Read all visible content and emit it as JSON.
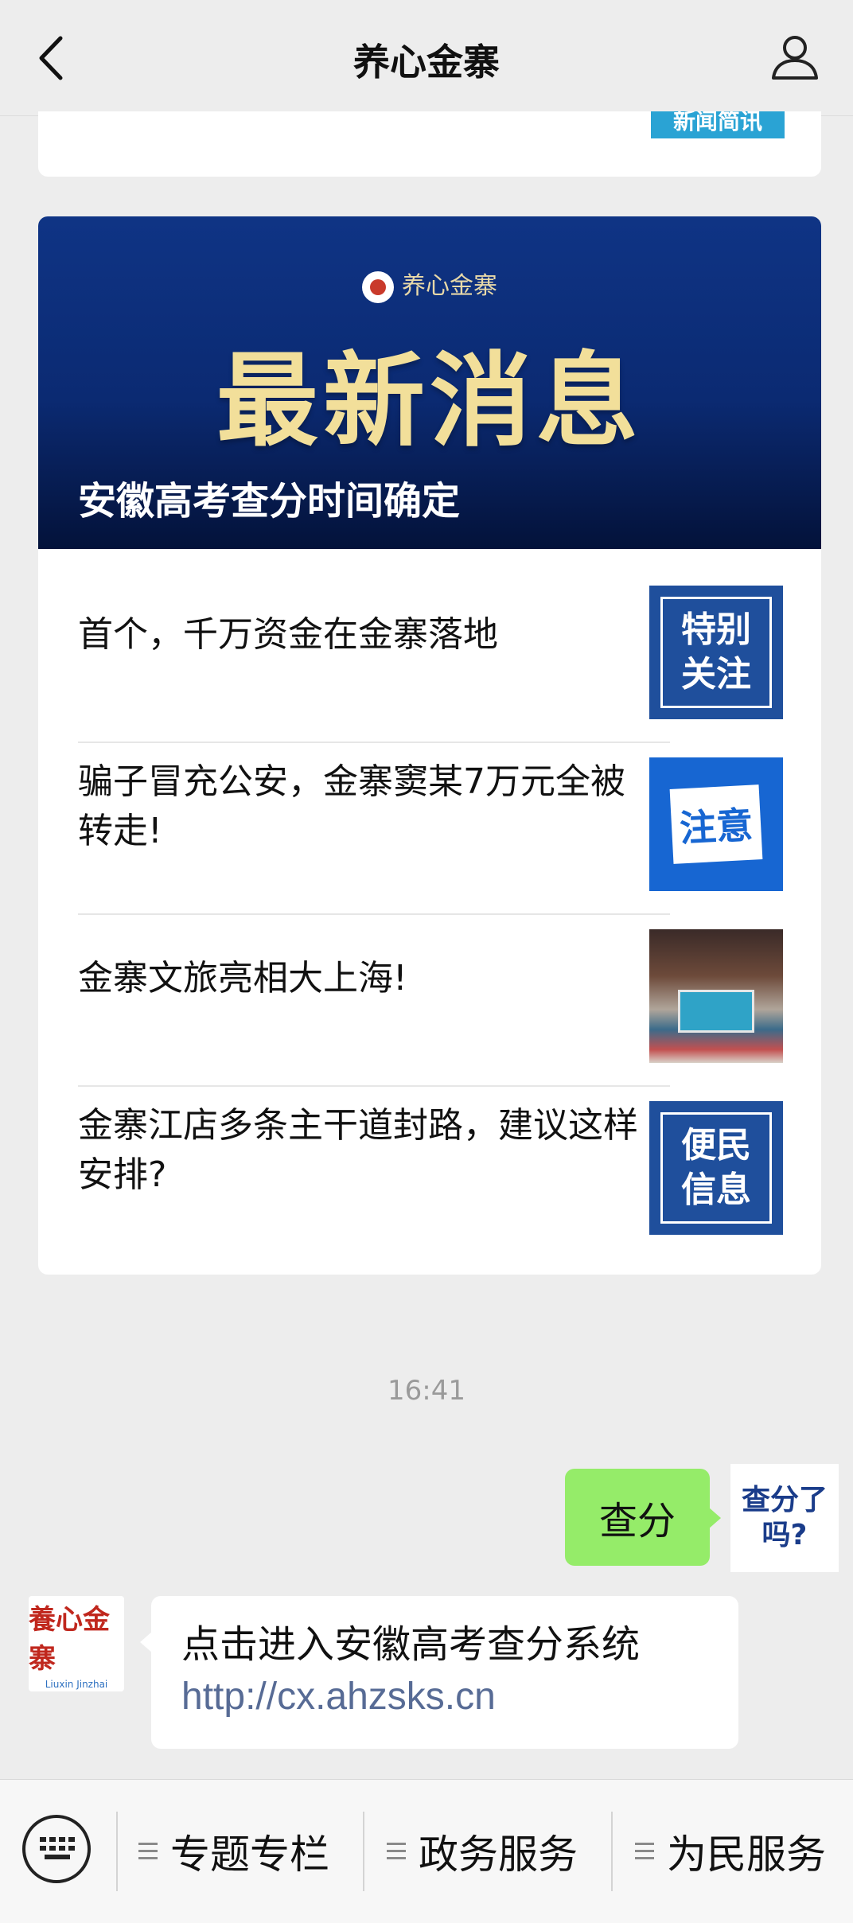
{
  "nav": {
    "title": "养心金寨"
  },
  "top_card": {
    "thumb_text": "新闻简讯"
  },
  "banner": {
    "brand": "养心金寨",
    "headline": "最新消息",
    "caption": "安徽高考查分时间确定"
  },
  "articles": [
    {
      "title": "首个，千万资金在金寨落地",
      "thumb_text": "特别关注"
    },
    {
      "title": "骗子冒充公安，金寨窦某7万元全被转走!",
      "thumb_text": "注意"
    },
    {
      "title": "金寨文旅亮相大上海!",
      "thumb_text": ""
    },
    {
      "title": "金寨江店多条主干道封路，建议这样安排?",
      "thumb_text": "便民信息"
    }
  ],
  "chat": {
    "timestamp": "16:41",
    "sent_message": "查分",
    "self_avatar_text": "查分了吗?",
    "bot_avatar_text": "養心金寨",
    "bot_avatar_sub": "Liuxin Jinzhai",
    "reply_line": "点击进入安徽高考查分系统",
    "reply_link": "http://cx.ahzsks.cn"
  },
  "menu": {
    "items": [
      "专题专栏",
      "政务服务",
      "为民服务"
    ]
  },
  "colors": {
    "page_bg": "#ededed",
    "sent_bubble": "#95ec69",
    "link": "#576b95",
    "banner_bg": "#0b2a72",
    "banner_headline": "#f2df9a"
  }
}
